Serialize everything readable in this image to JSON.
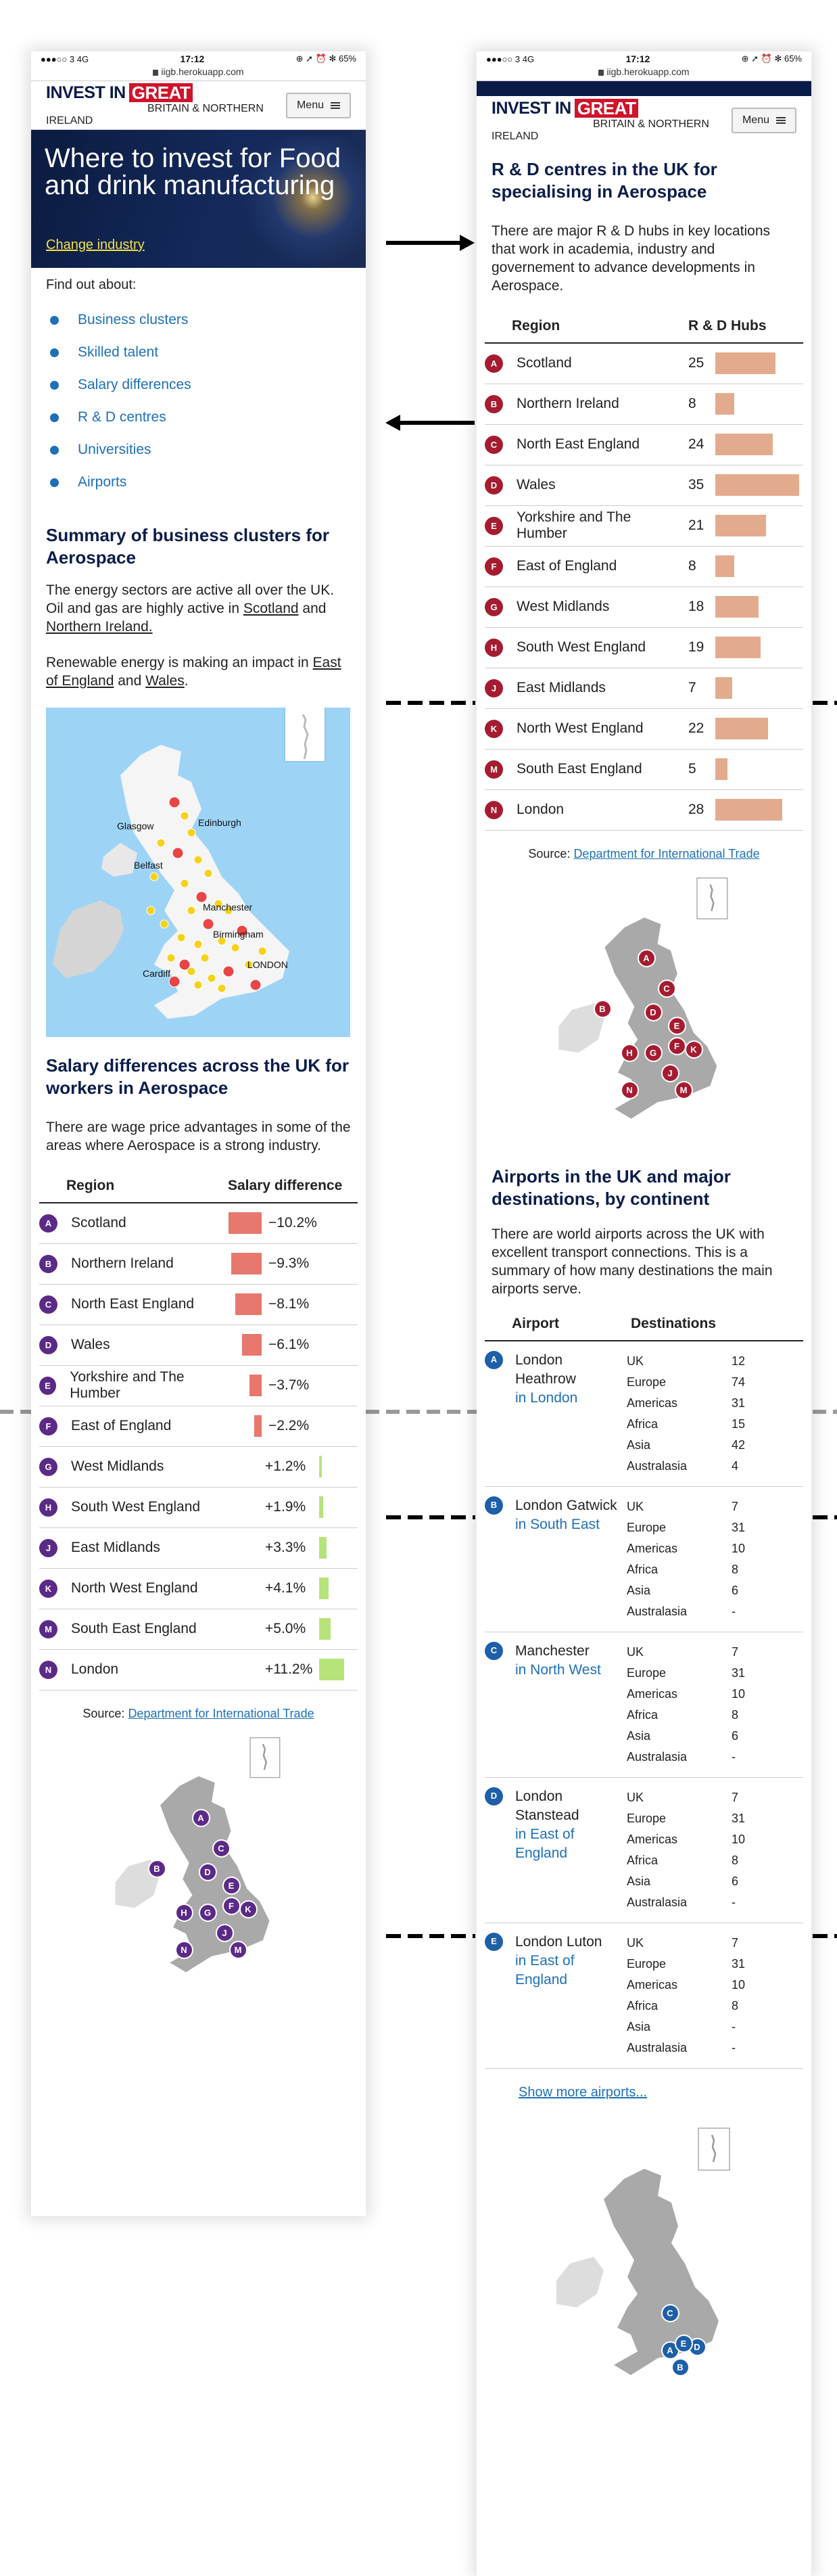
{
  "status": {
    "left": "●●●○○ 3  4G",
    "time": "17:12",
    "right": "⊕ ➚ ⏰ ✻ 65%"
  },
  "url": "iigb.herokuapp.com",
  "brand": {
    "invest": "INVEST IN",
    "great": "GREAT",
    "sub": "BRITAIN & NORTHERN IRELAND",
    "menu": "Menu"
  },
  "hero": {
    "title": "Where to invest for Food and drink manufacturing",
    "link": "Change industry"
  },
  "find": {
    "heading": "Find out about:",
    "items": [
      "Business clusters",
      "Skilled talent",
      "Salary differences",
      "R & D centres",
      "Universities",
      "Airports"
    ]
  },
  "clusters": {
    "title": "Summary of business clusters for Aerospace",
    "p1a": "The energy sectors are active all over the UK. Oil and gas are highly active in ",
    "p1b": "Scotland",
    "p1c": " and ",
    "p1d": "Northern Ireland.",
    "p2a": "Renewable energy is making an impact in ",
    "p2b": "East of England",
    "p2c": " and ",
    "p2d": "Wales",
    "p2e": ".",
    "cities": [
      "Edinburgh",
      "Glasgow",
      "Belfast",
      "Manchester",
      "Birmingham",
      "Cardiff",
      "LONDON"
    ]
  },
  "salary": {
    "title": "Salary differences across the UK for workers in Aerospace",
    "intro": "There are wage price advantages in some of the areas where Aerospace is a strong industry.",
    "col1": "Region",
    "col2": "Salary difference",
    "rows": [
      {
        "l": "A",
        "r": "Scotland",
        "v": "−10.2%",
        "n": -10.2
      },
      {
        "l": "B",
        "r": "Northern Ireland",
        "v": "−9.3%",
        "n": -9.3
      },
      {
        "l": "C",
        "r": "North East England",
        "v": "−8.1%",
        "n": -8.1
      },
      {
        "l": "D",
        "r": "Wales",
        "v": "−6.1%",
        "n": -6.1
      },
      {
        "l": "E",
        "r": "Yorkshire and The Humber",
        "v": "−3.7%",
        "n": -3.7
      },
      {
        "l": "F",
        "r": "East of England",
        "v": "−2.2%",
        "n": -2.2
      },
      {
        "l": "G",
        "r": "West Midlands",
        "v": "+1.2%",
        "n": 1.2
      },
      {
        "l": "H",
        "r": "South West England",
        "v": "+1.9%",
        "n": 1.9
      },
      {
        "l": "J",
        "r": "East Midlands",
        "v": "+3.3%",
        "n": 3.3
      },
      {
        "l": "K",
        "r": "North West England",
        "v": "+4.1%",
        "n": 4.1
      },
      {
        "l": "M",
        "r": "South East England",
        "v": "+5.0%",
        "n": 5.0
      },
      {
        "l": "N",
        "r": "London",
        "v": "+11.2%",
        "n": 11.2
      }
    ],
    "src_label": "Source: ",
    "src_link": "Department for International Trade",
    "color": "#5b2a86",
    "neg": "#e8776e",
    "pos": "#b6e37a"
  },
  "rd": {
    "title": "R & D centres in the UK for specialising in Aerospace",
    "intro": "There are major R & D hubs in key locations that work in academia, industry and governement to advance developments in Aerospace.",
    "col1": "Region",
    "col2": "R & D Hubs",
    "rows": [
      {
        "l": "A",
        "r": "Scotland",
        "v": "25",
        "n": 25
      },
      {
        "l": "B",
        "r": "Northern Ireland",
        "v": "8",
        "n": 8
      },
      {
        "l": "C",
        "r": "North East England",
        "v": "24",
        "n": 24
      },
      {
        "l": "D",
        "r": "Wales",
        "v": "35",
        "n": 35
      },
      {
        "l": "E",
        "r": "Yorkshire and The Humber",
        "v": "21",
        "n": 21
      },
      {
        "l": "F",
        "r": "East of England",
        "v": "8",
        "n": 8
      },
      {
        "l": "G",
        "r": "West Midlands",
        "v": "18",
        "n": 18
      },
      {
        "l": "H",
        "r": "South West England",
        "v": "19",
        "n": 19
      },
      {
        "l": "J",
        "r": "East Midlands",
        "v": "7",
        "n": 7
      },
      {
        "l": "K",
        "r": "North West England",
        "v": "22",
        "n": 22
      },
      {
        "l": "M",
        "r": "South East England",
        "v": "5",
        "n": 5
      },
      {
        "l": "N",
        "r": "London",
        "v": "28",
        "n": 28
      }
    ],
    "src_label": "Source: ",
    "src_link": "Department for International Trade",
    "color": "#a51c30",
    "bar": "#e3ab8d"
  },
  "airports": {
    "title": "Airports in the UK and major destinations, by continent",
    "intro": "There are world airports across the UK with excellent transport connections. This is a summary of how many destinations the main airports serve.",
    "col1": "Airport",
    "col2": "Destinations",
    "color": "#1d5fa8",
    "more": "Show more airports...",
    "list": [
      {
        "l": "A",
        "name": "London Heathrow",
        "loc": "in London",
        "d": [
          [
            "UK",
            "12"
          ],
          [
            "Europe",
            "74"
          ],
          [
            "Americas",
            "31"
          ],
          [
            "Africa",
            "15"
          ],
          [
            "Asia",
            "42"
          ],
          [
            "Australasia",
            "4"
          ]
        ]
      },
      {
        "l": "B",
        "name": "London Gatwick",
        "loc": "in South East",
        "d": [
          [
            "UK",
            "7"
          ],
          [
            "Europe",
            "31"
          ],
          [
            "Americas",
            "10"
          ],
          [
            "Africa",
            "8"
          ],
          [
            "Asia",
            "6"
          ],
          [
            "Australasia",
            "-"
          ]
        ]
      },
      {
        "l": "C",
        "name": "Manchester",
        "loc": "in North West",
        "d": [
          [
            "UK",
            "7"
          ],
          [
            "Europe",
            "31"
          ],
          [
            "Americas",
            "10"
          ],
          [
            "Africa",
            "8"
          ],
          [
            "Asia",
            "6"
          ],
          [
            "Australasia",
            "-"
          ]
        ]
      },
      {
        "l": "D",
        "name": "London Stanstead",
        "loc": "in East of England",
        "d": [
          [
            "UK",
            "7"
          ],
          [
            "Europe",
            "31"
          ],
          [
            "Americas",
            "10"
          ],
          [
            "Africa",
            "8"
          ],
          [
            "Asia",
            "6"
          ],
          [
            "Australasia",
            "-"
          ]
        ]
      },
      {
        "l": "E",
        "name": "London Luton",
        "loc": "in East of England",
        "d": [
          [
            "UK",
            "7"
          ],
          [
            "Europe",
            "31"
          ],
          [
            "Americas",
            "10"
          ],
          [
            "Africa",
            "8"
          ],
          [
            "Asia",
            "-"
          ],
          [
            "Australasia",
            "-"
          ]
        ]
      }
    ]
  }
}
